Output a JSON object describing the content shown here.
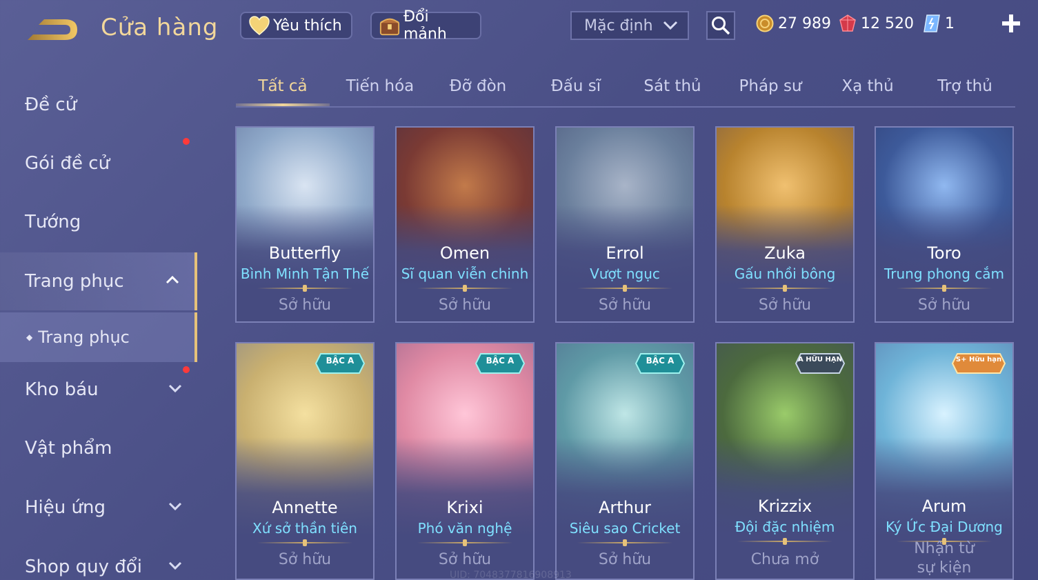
{
  "header": {
    "title": "Cửa hàng",
    "favorites_label": "Yêu thích",
    "exchange_label": "Đổi mảnh",
    "sort_value": "Mặc định"
  },
  "currency": {
    "gold": "27 989",
    "gems": "12 520",
    "vouchers": "1"
  },
  "sidebar": {
    "items": [
      {
        "label": "Đề cử"
      },
      {
        "label": "Gói đề cử"
      },
      {
        "label": "Tướng"
      },
      {
        "label": "Trang phục"
      },
      {
        "label": "Trang phục"
      },
      {
        "label": "Kho báu"
      },
      {
        "label": "Vật phẩm"
      },
      {
        "label": "Hiệu ứng"
      },
      {
        "label": "Shop quy đổi"
      }
    ]
  },
  "tabs": [
    {
      "label": "Tất cả"
    },
    {
      "label": "Tiến hóa"
    },
    {
      "label": "Đỡ đòn"
    },
    {
      "label": "Đấu sĩ"
    },
    {
      "label": "Sát thủ"
    },
    {
      "label": "Pháp sư"
    },
    {
      "label": "Xạ thủ"
    },
    {
      "label": "Trợ thủ"
    }
  ],
  "cards": [
    {
      "hero": "Butterfly",
      "skin": "Bình Minh Tận Thế",
      "status": "Sở hữu",
      "color": "#8fa9c9"
    },
    {
      "hero": "Omen",
      "skin": "Sĩ quan viễn chinh",
      "status": "Sở hữu",
      "color": "#7a3a34"
    },
    {
      "hero": "Errol",
      "skin": "Vượt ngục",
      "status": "Sở hữu",
      "color": "#6a7f9c"
    },
    {
      "hero": "Zuka",
      "skin": "Gấu nhồi bông",
      "status": "Sở hữu",
      "color": "#b8832e"
    },
    {
      "hero": "Toro",
      "skin": "Trung phong cắm",
      "status": "Sở hữu",
      "color": "#3d5a9a"
    },
    {
      "hero": "Annette",
      "skin": "Xứ sở thần tiên",
      "status": "Sở hữu",
      "badge": "BẬC A",
      "color": "#c9b070"
    },
    {
      "hero": "Krixi",
      "skin": "Phó văn nghệ",
      "status": "Sở hữu",
      "badge": "BẬC A",
      "color": "#e08aa4"
    },
    {
      "hero": "Arthur",
      "skin": "Siêu sao Cricket",
      "status": "Sở hữu",
      "badge": "BẬC A",
      "color": "#5f9aa6"
    },
    {
      "hero": "Krizzix",
      "skin": "Đội đặc nhiệm",
      "status": "Chưa mở",
      "badge": "A HỮU HẠN",
      "color": "#4c6a3e"
    },
    {
      "hero": "Arum",
      "skin": "Ký Ức Đại Dương",
      "status": "Nhận từ sự kiện",
      "badge": "S+ Hữu hạn",
      "color": "#6fb4d8"
    }
  ],
  "footer": {
    "uid": "UID: 7048377816908913"
  },
  "colors": {
    "accent_gold": "#f2d79b",
    "skin_name": "#7fe0ff",
    "notification": "#ff3a3a"
  }
}
